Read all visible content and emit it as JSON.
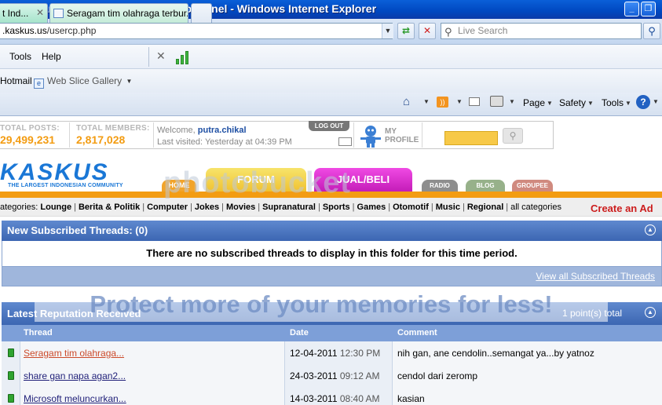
{
  "window": {
    "title": "ndonesian Community - User Control Panel - Windows Internet Explorer",
    "min_label": "_",
    "max_label": "❐"
  },
  "addressbar": {
    "url_domain": ".kaskus.us",
    "url_path": "/usercp.php",
    "search_placeholder": "Live Search"
  },
  "menu": {
    "items": [
      "Tools",
      "Help"
    ]
  },
  "favorites": {
    "hotmail": "Hotmail",
    "webslice": "Web Slice Gallery"
  },
  "tabs": [
    {
      "label": "t Ind..."
    },
    {
      "label": "Seragam tim olahraga terbur..."
    }
  ],
  "commandbar": {
    "page": "Page",
    "safety": "Safety",
    "tools": "Tools"
  },
  "stats": {
    "total_posts_label": "TOTAL POSTS:",
    "total_posts": "29,499,231",
    "total_members_label": "TOTAL MEMBERS:",
    "total_members": "2,817,028"
  },
  "user": {
    "welcome_prefix": "Welcome,",
    "username": "putra.chikal",
    "last_visited": "Last visited: Yesterday at 04:39 PM",
    "logout": "LOG OUT",
    "my_profile_1": "MY",
    "my_profile_2": "PROFILE"
  },
  "site": {
    "logo": "KASKUS",
    "tagline": "THE LARGEST INDONESIAN COMMUNITY",
    "nav": {
      "home": "HOME",
      "forum": "FORUM",
      "jual": "JUAL/BELI",
      "radio": "RADIO",
      "blog": "BLOG",
      "groupee": "GROUPEE"
    }
  },
  "categories": {
    "prefix": "ategories:",
    "items": [
      "Lounge",
      "Berita & Politik",
      "Computer",
      "Jokes",
      "Movies",
      "Supranatural",
      "Sports",
      "Games",
      "Otomotif",
      "Music",
      "Regional"
    ],
    "all": "all categories",
    "create_ad": "Create an Ad"
  },
  "subscribed": {
    "title": "New Subscribed Threads: (0)",
    "empty_msg": "There are no subscribed threads to display in this folder for this time period.",
    "view_all": "View all Subscribed Threads"
  },
  "reputation": {
    "title": "Latest Reputation Received",
    "total": "1 point(s) total",
    "columns": [
      "Thread",
      "Date",
      "Comment"
    ],
    "rows": [
      {
        "thread": "Seragam tim olahraga...",
        "date": "12-04-2011",
        "time": "12:30 PM",
        "comment": "nih gan, ane cendolin..semangat ya...by yatnoz"
      },
      {
        "thread": "share gan napa agan2...",
        "date": "24-03-2011",
        "time": "09:12 AM",
        "comment": "cendol dari zeromp"
      },
      {
        "thread": "Microsoft meluncurkan...",
        "date": "14-03-2011",
        "time": "08:40 AM",
        "comment": "kasian"
      }
    ]
  },
  "watermark": {
    "line1": "photobucket",
    "line2": "Protect more of your memories for less!"
  }
}
